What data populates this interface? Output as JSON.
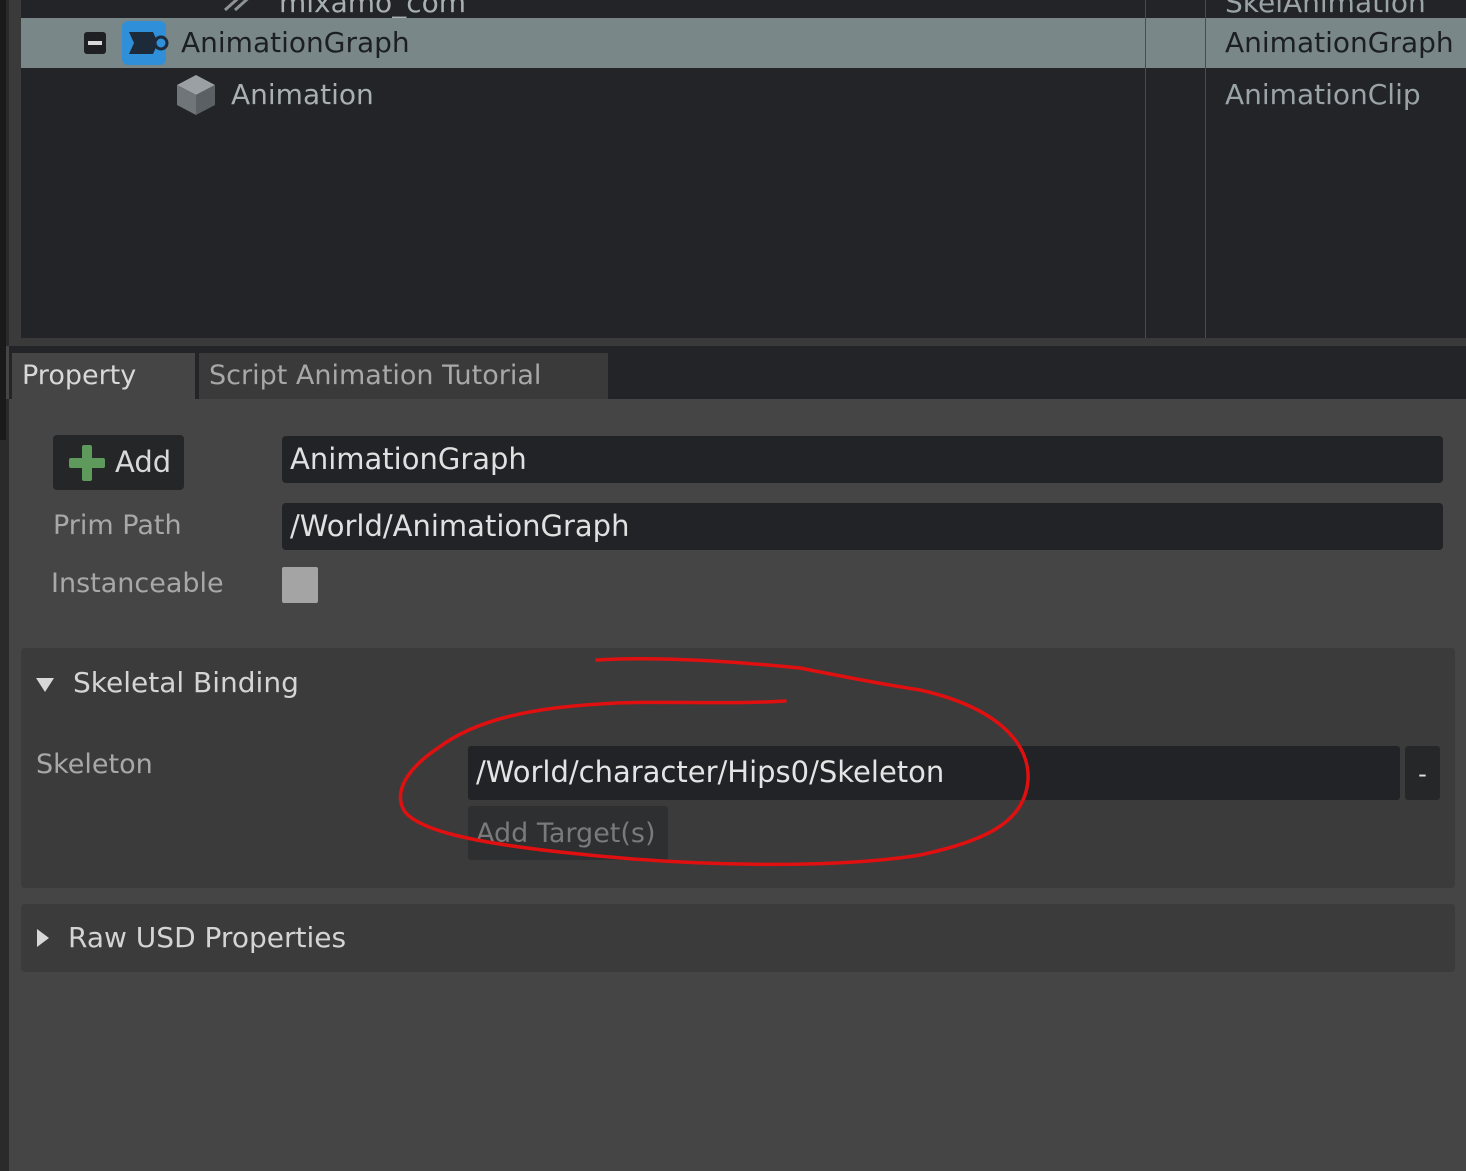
{
  "stage": {
    "rows": [
      {
        "name": "mixamo_com",
        "type": "SkelAnimation"
      },
      {
        "name": "AnimationGraph",
        "type": "AnimationGraph"
      },
      {
        "name": "Animation",
        "type": "AnimationClip"
      }
    ]
  },
  "tabs": [
    {
      "label": "Property",
      "active": true
    },
    {
      "label": "Script Animation Tutorial",
      "active": false
    }
  ],
  "property": {
    "add_label": "Add",
    "name_value": "AnimationGraph",
    "prim_path_label": "Prim Path",
    "prim_path_value": "/World/AnimationGraph",
    "instanceable_label": "Instanceable",
    "instanceable_checked": false
  },
  "skeletal_binding": {
    "title": "Skeletal Binding",
    "expanded": true,
    "skeleton_label": "Skeleton",
    "skeleton_value": "/World/character/Hips0/Skeleton",
    "remove_label": "-",
    "add_target_label": "Add Target(s)"
  },
  "raw_usd": {
    "title": "Raw USD Properties",
    "expanded": false
  },
  "colors": {
    "annotation": "#e01010",
    "selection": "#7a8789",
    "add_icon": "#5e9a5c",
    "graph_icon": "#2f8fd8"
  },
  "icons": {
    "collapse": "minus-box-icon",
    "graph": "animation-graph-icon",
    "clip": "cube-icon",
    "add": "plus-icon",
    "expanded": "triangle-down-icon",
    "collapsed": "triangle-right-icon"
  }
}
